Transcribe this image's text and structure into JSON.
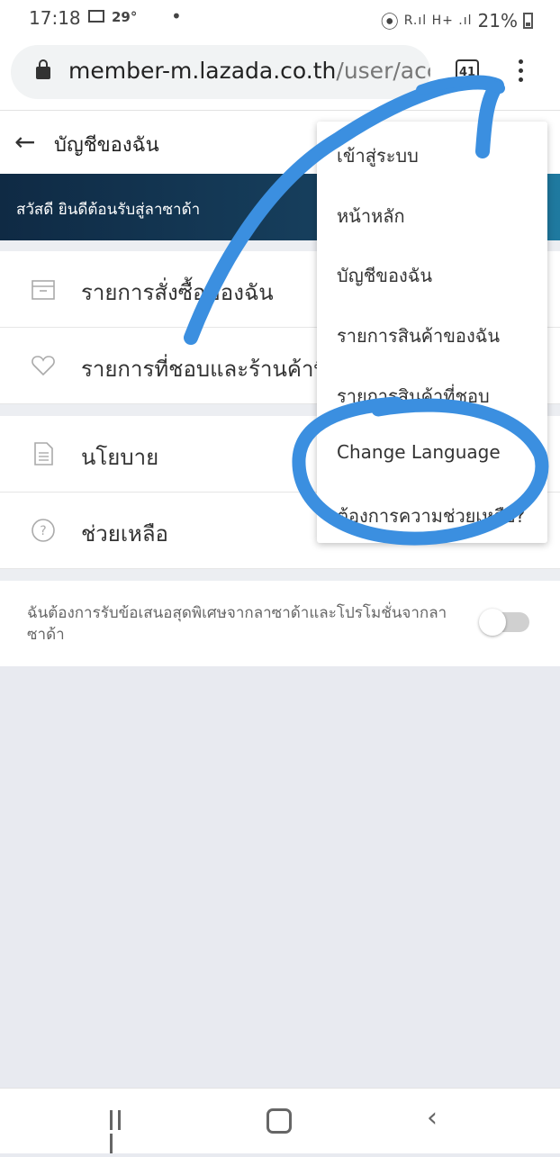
{
  "status": {
    "time": "17:18",
    "temp": "29°",
    "dot": "•",
    "signal": "R.ıl H+ .ıl",
    "battery": "21%"
  },
  "browser": {
    "url_host": "member-m.lazada.co.th",
    "url_path": "/user/acc",
    "tab_count": "41"
  },
  "header": {
    "back": "←",
    "title": "บัญชีของฉัน"
  },
  "banner": {
    "text": "สวัสดี ยินดีต้อนรับสู่ลาซาด้า"
  },
  "menu": {
    "orders": "รายการสั่งซื้อของฉัน",
    "wishlist": "รายการที่ชอบและร้านค้าที่ติดตาม",
    "policy": "นโยบาย",
    "help": "ช่วยเหลือ"
  },
  "promo": {
    "text": "ฉันต้องการรับข้อเสนอสุดพิเศษจากลาซาด้าและโปรโมชั่นจากลาซาด้า",
    "toggle_on": false
  },
  "dropdown": {
    "items": [
      "เข้าสู่ระบบ",
      "หน้าหลัก",
      "บัญชีของฉัน",
      "รายการสินค้าของฉัน",
      "รายการสินค้าที่ชอบ",
      "Change Language",
      "ต้องการความช่วยเหลือ?"
    ]
  },
  "nav": {
    "back": "‹"
  },
  "colors": {
    "annotation": "#3b8fe0",
    "banner_start": "#0f2a44",
    "banner_end": "#1f7aa0"
  }
}
